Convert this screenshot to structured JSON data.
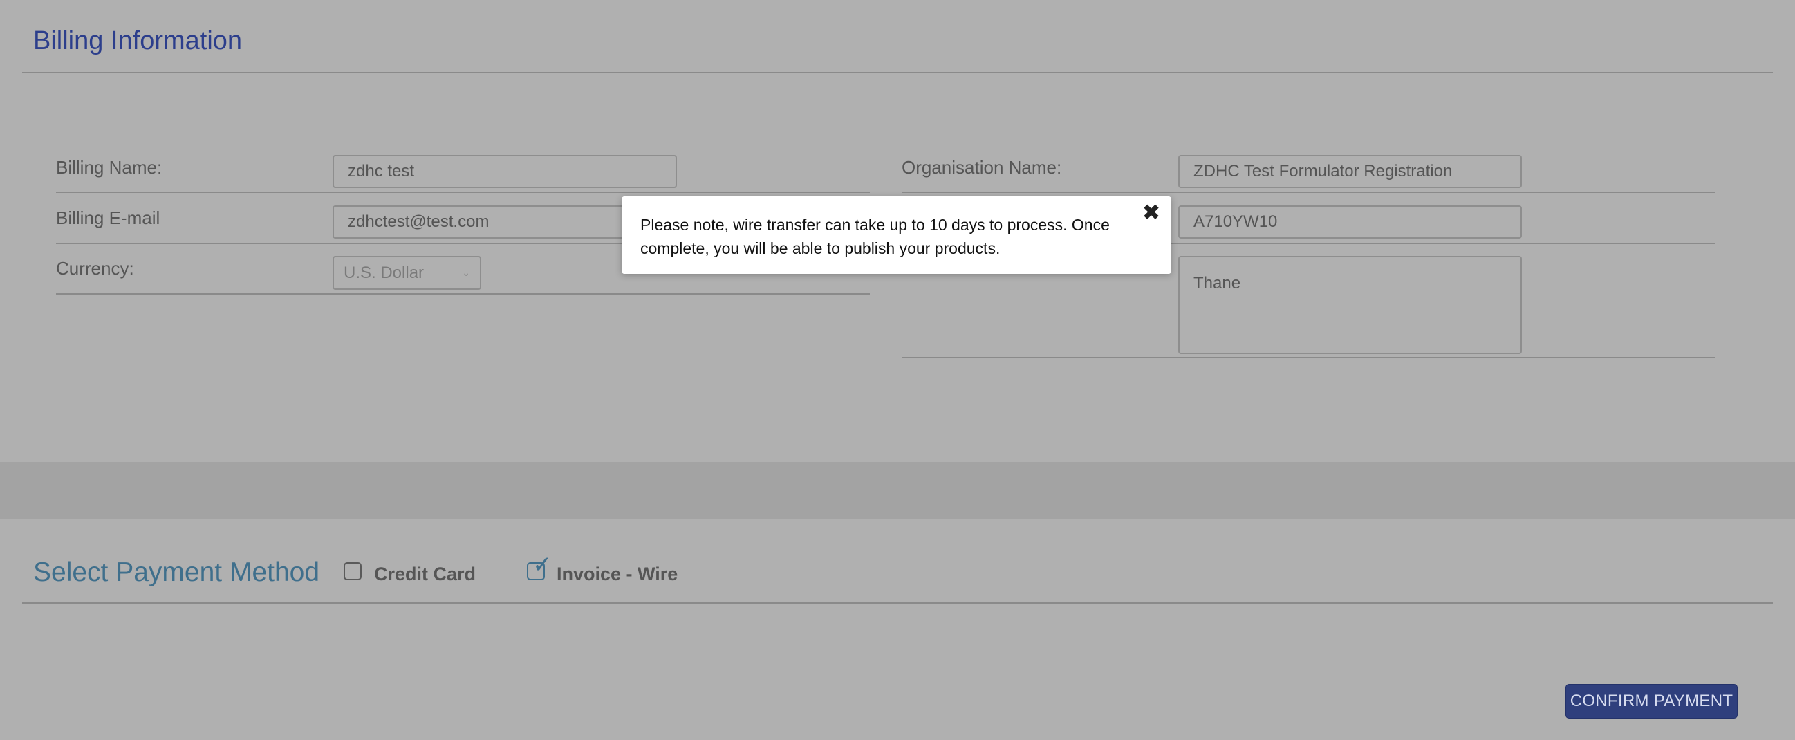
{
  "billing": {
    "title": "Billing Information",
    "fields": {
      "billing_name": {
        "label": "Billing Name:",
        "value": "zdhc test"
      },
      "billing_email": {
        "label": "Billing E-mail",
        "value": "zdhctest@test.com"
      },
      "currency": {
        "label": "Currency:",
        "value": "U.S. Dollar"
      },
      "organisation_name": {
        "label": "Organisation Name:",
        "value": "ZDHC Test Formulator Registration"
      },
      "org_id": {
        "value": "A710YW10"
      },
      "address": {
        "value": "Thane"
      }
    }
  },
  "popup": {
    "message": "Please note, wire transfer can take up to 10 days to process. Once complete, you will be able to publish your products.",
    "close_glyph": "✖"
  },
  "payment": {
    "title": "Select Payment Method",
    "options": [
      {
        "label": "Credit Card",
        "checked": false
      },
      {
        "label": "Invoice - Wire",
        "checked": true
      }
    ],
    "confirm_label": "CONFIRM PAYMENT"
  },
  "colors": {
    "page_overlay": "#b0b0b0",
    "title_blue": "#2c3e8c",
    "payment_title": "#3f6f8c",
    "button_bg": "#2f3f7d",
    "popup_bg": "#ffffff"
  }
}
